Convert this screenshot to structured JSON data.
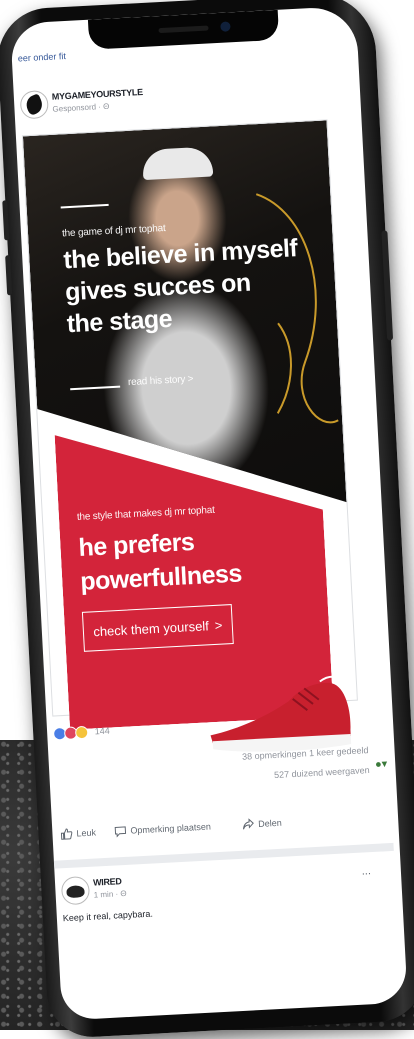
{
  "feed": {
    "prev_post_snippet": "eer onder fit"
  },
  "post": {
    "page_name": "MYGAMEYOURSTYLE",
    "sponsored_label": "Gesponsord · Θ",
    "ad": {
      "story_subtitle": "the game of dj mr tophat",
      "story_headline_1": "the believe in myself",
      "story_headline_2": "gives succes on",
      "story_headline_3": "the stage",
      "story_link": "read his story >",
      "style_subtitle": "the style that makes dj mr tophat",
      "style_headline_1": "he prefers",
      "style_headline_2": "powerfullness",
      "cta_label": "check them yourself",
      "cta_chevron": ">"
    },
    "reactions": {
      "count": "144"
    },
    "stats": {
      "comments_shares": "38 opmerkingen 1 keer gedeeld",
      "views": "527 duizend weergaven"
    },
    "actions": {
      "like": "Leuk",
      "comment": "Opmerking plaatsen",
      "share": "Delen"
    }
  },
  "post2": {
    "page_name": "WIRED",
    "time": "1 min · Θ",
    "text": "Keep it real, capybara.",
    "more": "..."
  },
  "colors": {
    "ad_red": "#d3243a",
    "link_blue": "#365899",
    "meta_gray": "#90949c"
  }
}
